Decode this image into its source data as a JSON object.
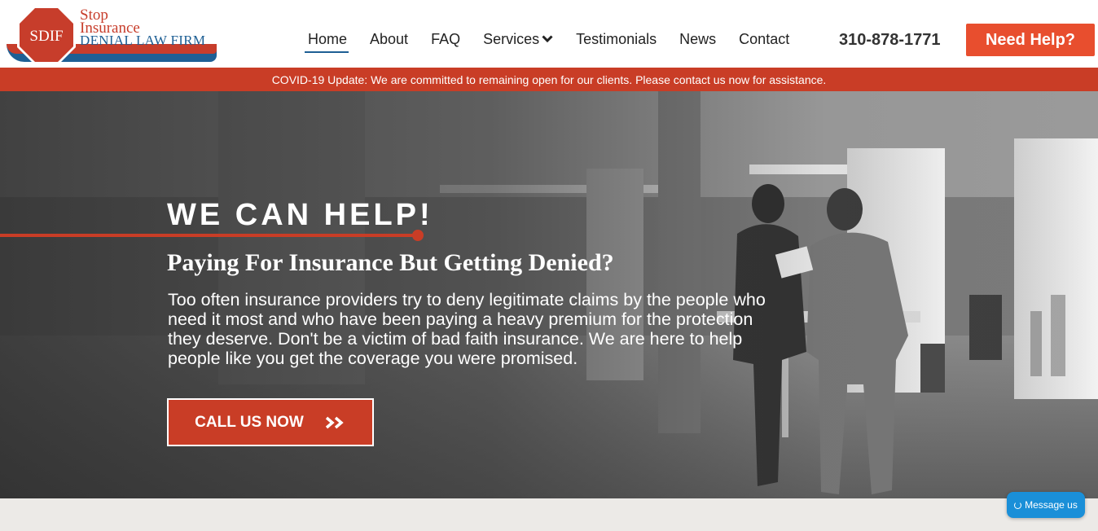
{
  "header": {
    "logo": {
      "badge": "SDIF",
      "line1": "Stop",
      "line2": "Insurance",
      "line3a": "DENIAL",
      "line3b": "LAW FIRM"
    },
    "nav": [
      {
        "label": "Home",
        "active": true
      },
      {
        "label": "About"
      },
      {
        "label": "FAQ"
      },
      {
        "label": "Services",
        "icon": "chevron-down-icon"
      },
      {
        "label": "Testimonials"
      },
      {
        "label": "News"
      },
      {
        "label": "Contact"
      }
    ],
    "phone": "310-878-1771",
    "cta_label": "Need Help?"
  },
  "notice": "COVID-19 Update: We are committed to remaining open for our clients. Please contact us now for assistance.",
  "hero": {
    "title": "WE CAN HELP!",
    "subtitle": "Paying For Insurance But Getting Denied?",
    "body": "Too often insurance providers try to deny legitimate claims by the people who need it most and who have been paying a heavy premium for the protection they deserve. Don't be a victim of bad faith insurance. We are here to help people like you get the coverage you were promised.",
    "cta_label": "CALL US NOW"
  },
  "chat_widget": {
    "label": "Message us"
  },
  "colors": {
    "accent": "#c93d26",
    "brand_blue": "#1e5f94",
    "button": "#e84e2e",
    "chat": "#1a8fd8"
  }
}
